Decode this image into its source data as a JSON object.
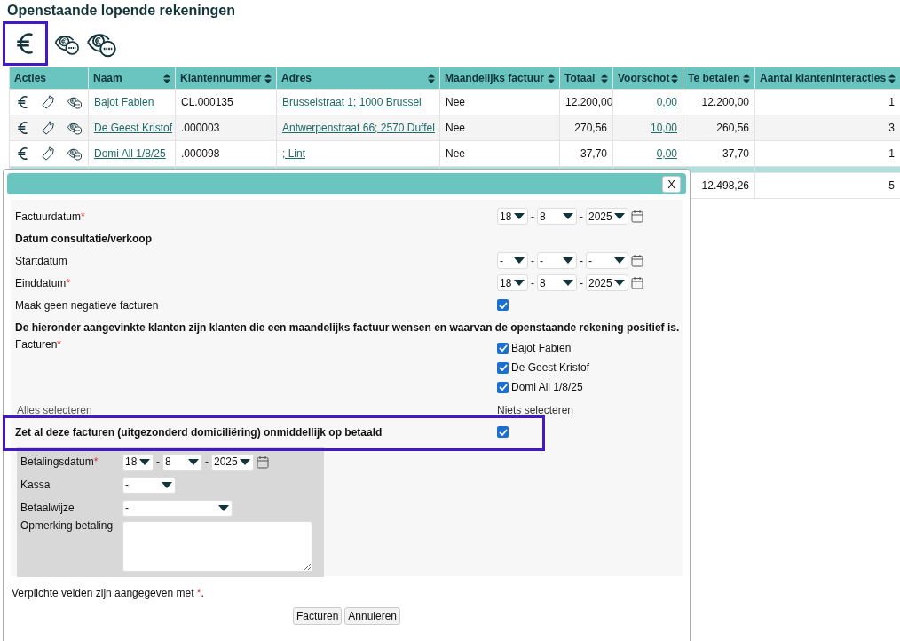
{
  "title": "Openstaande lopende rekeningen",
  "table": {
    "columns": [
      {
        "label": "Acties",
        "sortable": false
      },
      {
        "label": "Naam",
        "sortable": true
      },
      {
        "label": "Klantennummer",
        "sortable": true
      },
      {
        "label": "Adres",
        "sortable": true
      },
      {
        "label": "Maandelijks factuur",
        "sortable": true
      },
      {
        "label": "Totaal",
        "sortable": true
      },
      {
        "label": "Voorschot",
        "sortable": true
      },
      {
        "label": "Te betalen",
        "sortable": true
      },
      {
        "label": "Aantal klanteninteracties",
        "sortable": true
      }
    ],
    "rows": [
      {
        "naam": "Bajot Fabien",
        "klantennummer": "CL.000135",
        "adres": "Brusselstraat 1; 1000 Brussel",
        "maandelijks": "Nee",
        "totaal": "12.200,00",
        "voorschot": "0,00",
        "te_betalen": "12.200,00",
        "aantal": "1"
      },
      {
        "naam": "De Geest Kristof",
        "klantennummer": ".000003",
        "adres": "Antwerpenstraat 66; 2570 Duffel",
        "maandelijks": "Nee",
        "totaal": "270,56",
        "voorschot": "10,00",
        "te_betalen": "260,56",
        "aantal": "3"
      },
      {
        "naam": "Domi All 1/8/25",
        "klantennummer": ".000098",
        "adres": "; Lint",
        "maandelijks": "Nee",
        "totaal": "37,70",
        "voorschot": "0,00",
        "te_betalen": "37,70",
        "aantal": "1"
      }
    ],
    "totals": {
      "te_betalen": "12.498,26",
      "aantal": "5"
    }
  },
  "dialog": {
    "close": "X",
    "fields": [
      {
        "kind": "date",
        "label": "Factuurdatum",
        "mark": "*",
        "separator": "-",
        "parts": [
          "18",
          "8",
          "2025"
        ]
      },
      {
        "kind": "heading",
        "label": "Datum consultatie/verkoop"
      },
      {
        "kind": "date",
        "label": "Startdatum",
        "separator": "-",
        "parts": [
          "-",
          "-",
          "-"
        ]
      },
      {
        "kind": "date",
        "label": "Einddatum",
        "mark": "*",
        "separator": "-",
        "parts": [
          "18",
          "8",
          "2025"
        ]
      },
      {
        "kind": "checkbox",
        "label": "Maak geen negatieve facturen",
        "checked": true
      },
      {
        "kind": "heading",
        "label": "De hieronder aangevinkte klanten zijn klanten die een maandelijks factuur wensen en waarvan de openstaande rekening positief is."
      },
      {
        "kind": "checklist",
        "label": "Facturen",
        "mark": "*",
        "items": [
          {
            "label": "Bajot Fabien",
            "checked": true
          },
          {
            "label": "De Geest Kristof",
            "checked": true
          },
          {
            "label": "Domi All 1/8/25",
            "checked": true
          }
        ]
      },
      {
        "kind": "links",
        "left": "Alles selecteren",
        "right": "Niets selecteren"
      },
      {
        "kind": "checkbox_strong",
        "label": "Zet al deze facturen (uitgezonderd domiciliëring) onmiddellijk op betaald",
        "checked": true,
        "highlighted": true
      }
    ],
    "payment": [
      {
        "kind": "date",
        "label": "Betalingsdatum",
        "mark": "*",
        "separator": "-",
        "parts": [
          "18",
          "8",
          "2025"
        ]
      },
      {
        "kind": "select",
        "label": "Kassa",
        "value": "-"
      },
      {
        "kind": "select_wide",
        "label": "Betaalwijze",
        "value": "-"
      },
      {
        "kind": "textarea",
        "label": "Opmerking betaling"
      }
    ],
    "note": "Verplichte velden zijn aangegeven met ",
    "note_mark": "*",
    "note_end": ".",
    "buttons": [
      "Facturen",
      "Annuleren"
    ]
  }
}
